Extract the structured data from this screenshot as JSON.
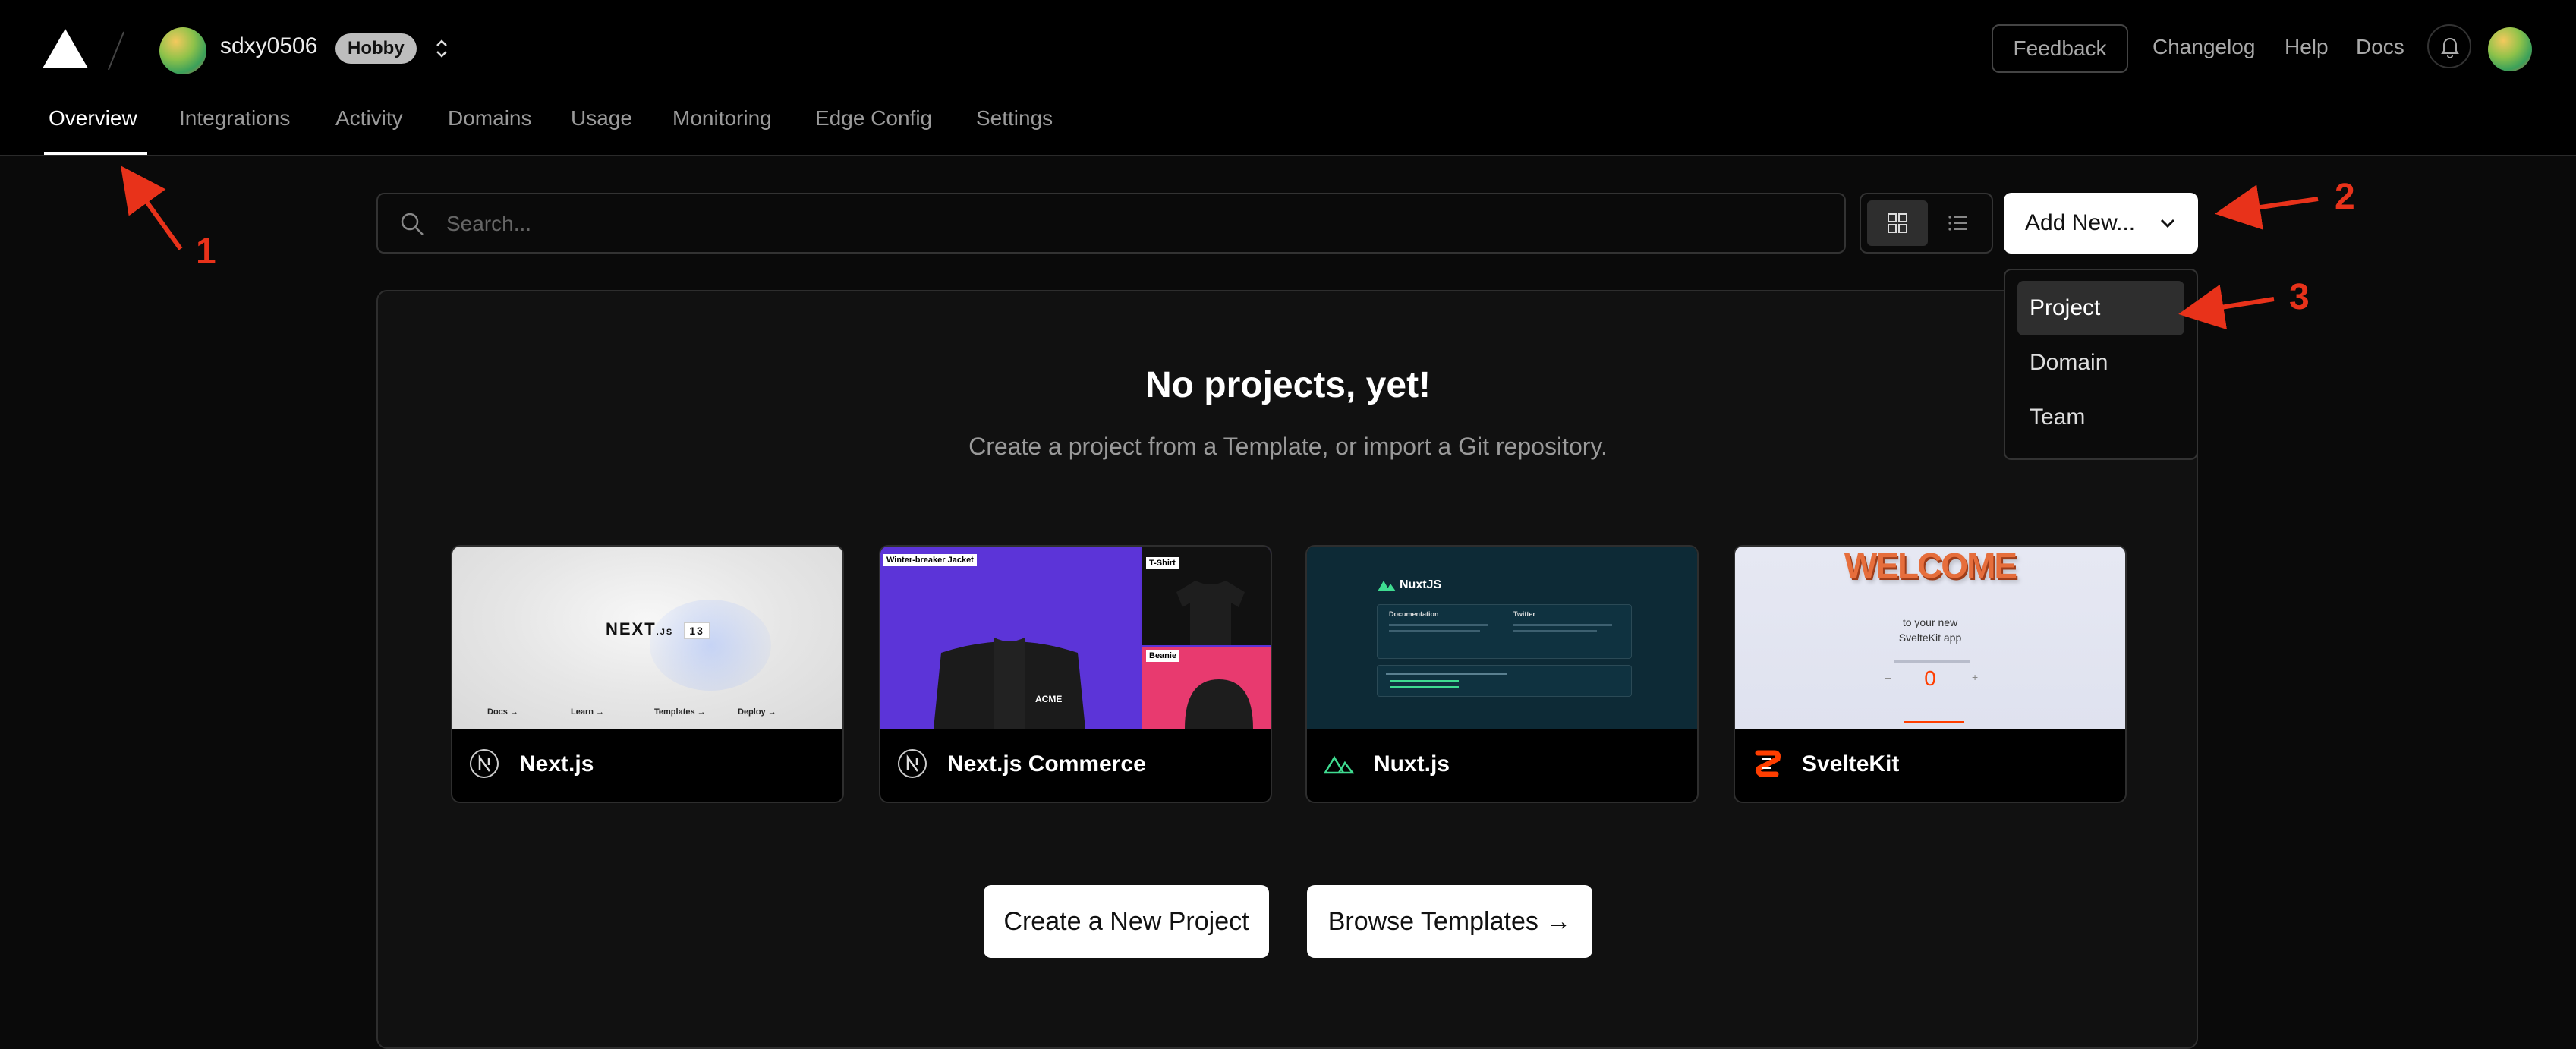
{
  "header": {
    "username": "sdxy0506",
    "plan_badge": "Hobby",
    "feedback": "Feedback",
    "links": [
      "Changelog",
      "Help",
      "Docs"
    ]
  },
  "tabs": [
    "Overview",
    "Integrations",
    "Activity",
    "Domains",
    "Usage",
    "Monitoring",
    "Edge Config",
    "Settings"
  ],
  "search": {
    "placeholder": "Search..."
  },
  "add_new": {
    "label": "Add New...",
    "menu": [
      "Project",
      "Domain",
      "Team"
    ]
  },
  "empty_state": {
    "title": "No projects, yet!",
    "subtitle": "Create a project from a Template, or import a Git repository."
  },
  "templates": [
    {
      "name": "Next.js",
      "icon": "nextjs-icon"
    },
    {
      "name": "Next.js Commerce",
      "icon": "nextjs-icon"
    },
    {
      "name": "Nuxt.js",
      "icon": "nuxt-icon"
    },
    {
      "name": "SvelteKit",
      "icon": "svelte-icon"
    }
  ],
  "thumbs": {
    "next": {
      "wordmark": "NEXT",
      "sup": ".JS",
      "version": "13",
      "links": [
        "Docs →",
        "Learn →",
        "Templates →",
        "Deploy →"
      ]
    },
    "commerce": {
      "product1": "Winter-breaker Jacket",
      "product2": "T-Shirt",
      "product3": "Beanie",
      "jacket_logo": "ACME"
    },
    "nuxt": {
      "logo": "NuxtJS",
      "col1": "Documentation",
      "col2": "Twitter"
    },
    "svelte": {
      "welcome": "WELCOME",
      "line1": "to your new",
      "line2": "SvelteKit app",
      "counter": "0",
      "minus": "–",
      "plus": "+"
    }
  },
  "actions": {
    "create": "Create a New Project",
    "browse": "Browse Templates →"
  },
  "annotations": [
    "1",
    "2",
    "3"
  ],
  "colors": {
    "annotation": "#e8321a",
    "accent_white": "#ffffff",
    "background": "#0a0a0a"
  }
}
